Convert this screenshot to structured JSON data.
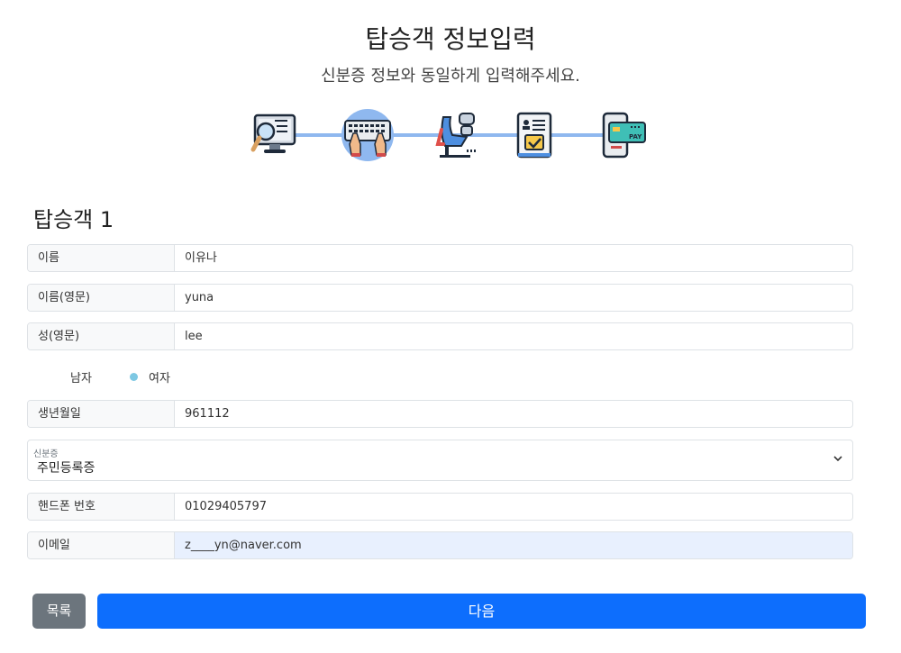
{
  "header": {
    "title": "탑승객 정보입력",
    "subtitle": "신분증 정보와 동일하게 입력해주세요."
  },
  "steps": [
    {
      "icon": "monitor-search-icon"
    },
    {
      "icon": "keyboard-typing-icon",
      "active": true
    },
    {
      "icon": "airplane-seat-icon"
    },
    {
      "icon": "id-card-check-icon"
    },
    {
      "icon": "mobile-pay-icon"
    }
  ],
  "passenger": {
    "section_title": "탑승객 1",
    "fields": {
      "name": {
        "label": "이름",
        "value": "이유나"
      },
      "name_en": {
        "label": "이름(영문)",
        "value": "yuna"
      },
      "surname_en": {
        "label": "성(영문)",
        "value": "lee"
      },
      "birthdate": {
        "label": "생년월일",
        "value": "961112"
      },
      "phone": {
        "label": "핸드폰 번호",
        "value": "01029405797"
      },
      "email": {
        "label": "이메일",
        "value": "z____yn@naver.com"
      }
    },
    "gender": {
      "male": "남자",
      "female": "여자",
      "selected": "여자"
    },
    "id_type": {
      "label": "신분증",
      "value": "주민등록증"
    }
  },
  "buttons": {
    "list": "목록",
    "next": "다음"
  },
  "colors": {
    "primary": "#0d6efd",
    "secondary": "#6c757d",
    "radio": "#7ec8e3",
    "autofill": "#e8f0fe"
  }
}
